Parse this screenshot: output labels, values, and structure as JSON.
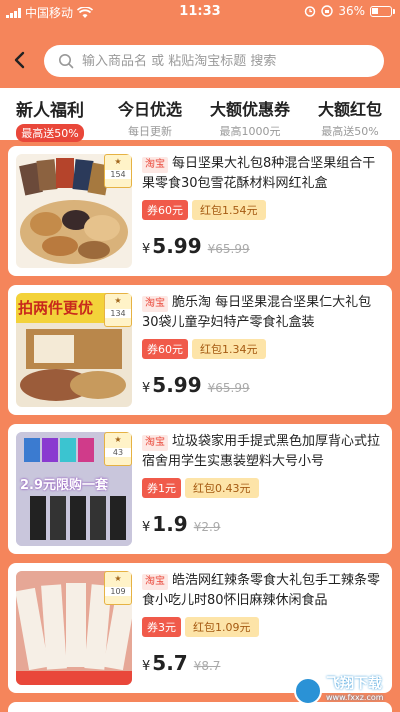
{
  "status_bar": {
    "carrier": "中国移动",
    "time": "11:33",
    "battery": "36%"
  },
  "search": {
    "placeholder": "输入商品名 或 粘贴淘宝标题 搜索"
  },
  "tabs": [
    {
      "title": "新人福利",
      "sub": "最高送50%"
    },
    {
      "title": "今日优选",
      "sub": "每日更新"
    },
    {
      "title": "大额优惠券",
      "sub": "最高1000元"
    },
    {
      "title": "大额红包",
      "sub": "最高送50%"
    }
  ],
  "products": [
    {
      "platform": "淘宝",
      "title": "每日坚果大礼包8种混合坚果组合干果零食30包雪花酥材料网红礼盒",
      "coupon": "券60元",
      "redbag": "红包1.54元",
      "currency": "¥",
      "price": "5.99",
      "old_price": "¥65.99",
      "badge_num": "154",
      "image_text": ""
    },
    {
      "platform": "淘宝",
      "title": "脆乐淘 每日坚果混合坚果仁大礼包30袋儿童孕妇特产零食礼盒装",
      "coupon": "券60元",
      "redbag": "红包1.34元",
      "currency": "¥",
      "price": "5.99",
      "old_price": "¥65.99",
      "badge_num": "134",
      "image_text": "拍两件更优"
    },
    {
      "platform": "淘宝",
      "title": "垃圾袋家用手提式黑色加厚背心式拉宿舍用学生实惠装塑料大号小号",
      "coupon": "券1元",
      "redbag": "红包0.43元",
      "currency": "¥",
      "price": "1.9",
      "old_price": "¥2.9",
      "badge_num": "43",
      "image_text": "2.9元限购一套"
    },
    {
      "platform": "淘宝",
      "title": "皓浩网红辣条零食大礼包手工辣条零食小吃儿时80怀旧麻辣休闲食品",
      "coupon": "券3元",
      "redbag": "红包1.09元",
      "currency": "¥",
      "price": "5.7",
      "old_price": "¥8.7",
      "badge_num": "109",
      "image_text": ""
    }
  ],
  "watermark": {
    "title": "飞翔下载",
    "sub": "www.fxxz.com"
  }
}
